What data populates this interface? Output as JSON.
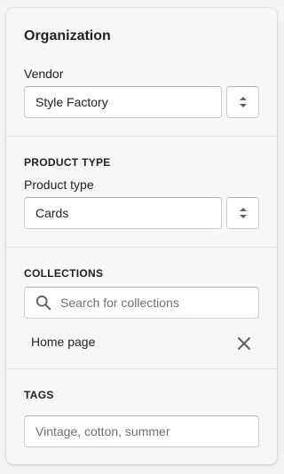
{
  "organization": {
    "title": "Organization",
    "vendor_label": "Vendor",
    "vendor_value": "Style Factory"
  },
  "product_type": {
    "heading": "PRODUCT TYPE",
    "label": "Product type",
    "value": "Cards"
  },
  "collections": {
    "heading": "COLLECTIONS",
    "search_placeholder": "Search for collections",
    "items": [
      {
        "label": "Home page"
      }
    ]
  },
  "tags": {
    "heading": "TAGS",
    "placeholder": "Vintage, cotton, summer"
  },
  "icons": {
    "stepper": "select-stepper-icon",
    "search": "search-icon",
    "remove": "close-icon"
  }
}
